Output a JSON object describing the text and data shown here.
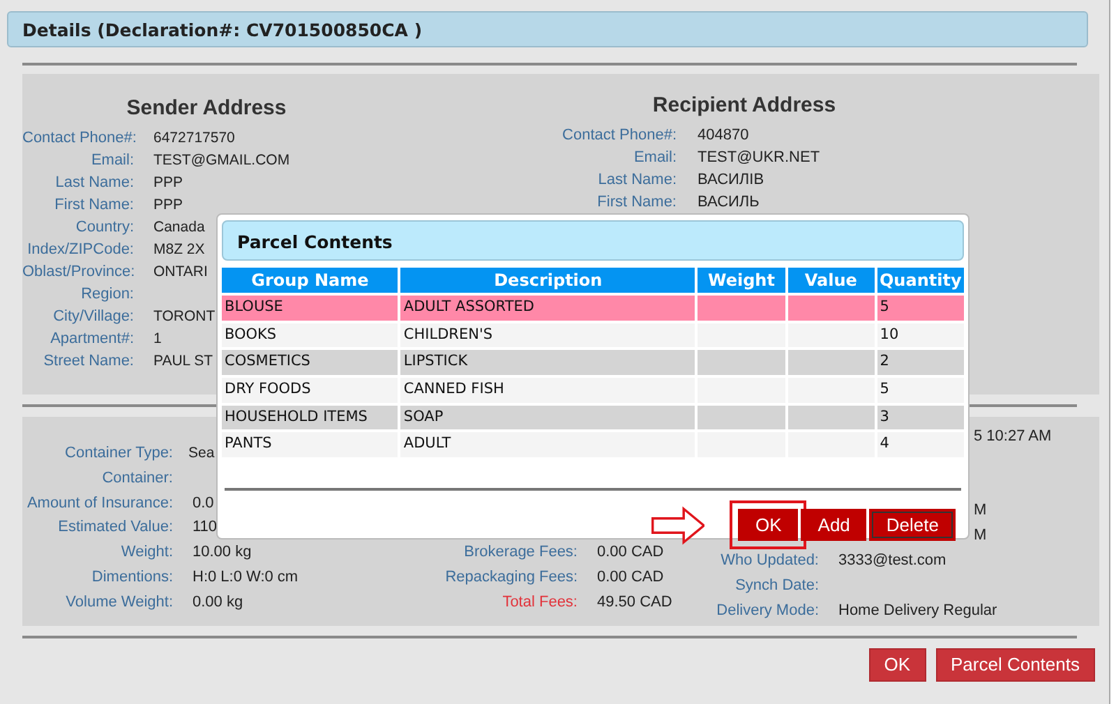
{
  "dialog": {
    "title": "Details (Declaration#: CV701500850CA )"
  },
  "sender": {
    "heading": "Sender Address",
    "fields": [
      {
        "label": "Contact Phone#:",
        "value": "6472717570"
      },
      {
        "label": "Email:",
        "value": "TEST@GMAIL.COM"
      },
      {
        "label": "Last Name:",
        "value": "PPP"
      },
      {
        "label": "First Name:",
        "value": "PPP"
      },
      {
        "label": "Country:",
        "value": "Canada"
      },
      {
        "label": "Index/ZIPCode:",
        "value": "M8Z 2X"
      },
      {
        "label": "Oblast/Province:",
        "value": "ONTARI"
      },
      {
        "label": "Region:"
      },
      {
        "label": "City/Village:",
        "value": "TORONT"
      },
      {
        "label": "Apartment#:",
        "value": "1"
      },
      {
        "label": "Street Name:",
        "value": "PAUL ST"
      }
    ]
  },
  "recipient": {
    "heading": "Recipient Address",
    "fields": [
      {
        "label": "Contact Phone#:",
        "value": "404870"
      },
      {
        "label": "Email:",
        "value": "TEST@UKR.NET"
      },
      {
        "label": "Last Name:",
        "value": "ВАСИЛІВ"
      },
      {
        "label": "First Name:",
        "value": "ВАСИЛЬ"
      }
    ]
  },
  "shipment": {
    "column_1": [
      {
        "kind": "field",
        "label": "Container Type:",
        "value": "Sea"
      },
      {
        "kind": "field",
        "label": "Container:"
      },
      {
        "kind": "field",
        "label": "Amount of Insurance:",
        "value": "0.0"
      },
      {
        "kind": "field",
        "label": "Estimated Value:",
        "value": "110"
      },
      {
        "kind": "field",
        "label": "Weight:",
        "value": "10.00 kg"
      },
      {
        "kind": "field",
        "label": "Dimentions:",
        "value": "H:0 L:0 W:0 cm"
      },
      {
        "kind": "field",
        "label": "Volume Weight:",
        "value": "0.00 kg"
      }
    ],
    "column_2": [
      {
        "kind": "field",
        "label": "Brokerage Fees:",
        "value": "0.00 CAD"
      },
      {
        "kind": "field",
        "label": "Repackaging Fees:",
        "value": "0.00 CAD"
      },
      {
        "kind": "total",
        "label": "Total Fees:",
        "value": "49.50 CAD"
      }
    ],
    "column_3": [
      {
        "kind": "fragment",
        "value": "5 10:27 AM"
      },
      {
        "kind": "fragment",
        "value": "M"
      },
      {
        "kind": "fragment",
        "value": "M"
      },
      {
        "kind": "field",
        "label": "Who Updated:",
        "value": "3333@test.com"
      },
      {
        "kind": "field",
        "label": "Synch Date:"
      },
      {
        "kind": "field",
        "label": "Delivery Mode:",
        "value": "Home Delivery Regular"
      }
    ]
  },
  "buttons": [
    {
      "label": "OK"
    },
    {
      "label": "Parcel Contents"
    }
  ],
  "parcel_contents": {
    "title": "Parcel Contents",
    "columns": [
      "Group Name",
      "Description",
      "Weight",
      "Value",
      "Quantity"
    ],
    "rows": [
      {
        "selected": true,
        "cells": [
          "BLOUSE",
          "ADULT ASSORTED",
          "5"
        ]
      },
      {
        "selected": false,
        "cells": [
          "BOOKS",
          "CHILDREN'S",
          "10"
        ]
      },
      {
        "selected": false,
        "cells": [
          "COSMETICS",
          "LIPSTICK",
          "2"
        ]
      },
      {
        "selected": false,
        "cells": [
          "DRY FOODS",
          "CANNED FISH",
          "5"
        ]
      },
      {
        "selected": false,
        "cells": [
          "HOUSEHOLD ITEMS",
          "SOAP",
          "3"
        ]
      },
      {
        "selected": false,
        "cells": [
          "PANTS",
          "ADULT",
          "4"
        ]
      }
    ],
    "buttons": [
      {
        "label": "OK",
        "highlighted": true,
        "focused": false
      },
      {
        "label": "Add",
        "highlighted": false,
        "focused": false
      },
      {
        "label": "Delete",
        "highlighted": false,
        "focused": true
      }
    ]
  }
}
